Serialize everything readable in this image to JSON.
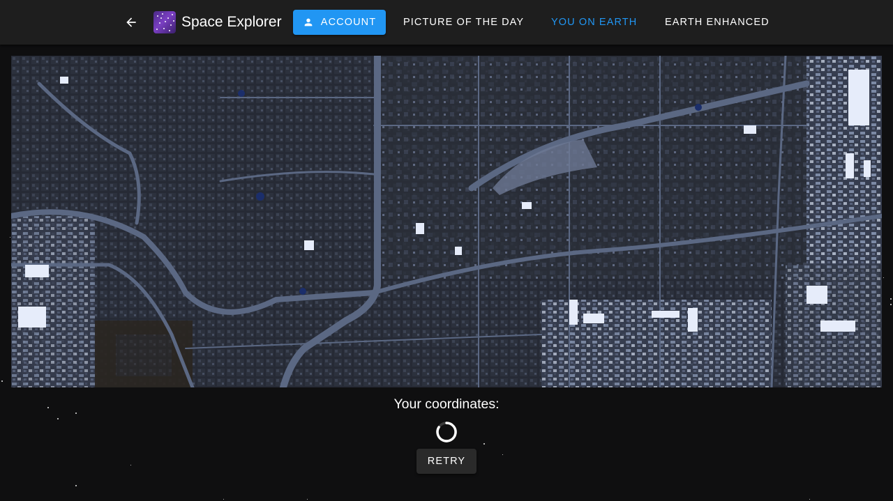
{
  "header": {
    "back_icon": "arrow-left-icon",
    "logo_icon": "galaxy-logo-icon",
    "app_title": "Space Explorer",
    "nav": {
      "account": {
        "label": "Account",
        "icon": "person-icon",
        "accent": "#2196f3"
      },
      "picture_of_day": {
        "label": "Picture of the day"
      },
      "you_on_earth": {
        "label": "You on earth",
        "active": true,
        "accent": "#2196f3"
      },
      "earth_enhanced": {
        "label": "Earth enhanced"
      }
    }
  },
  "main": {
    "satellite_image": {
      "description_icon": "satellite-image"
    },
    "coordinates_label": "Your coordinates:",
    "loading": true,
    "retry_label": "Retry"
  },
  "colors": {
    "background": "#0f0f10",
    "appbar": "#1e1e1e",
    "accent": "#2196f3"
  }
}
